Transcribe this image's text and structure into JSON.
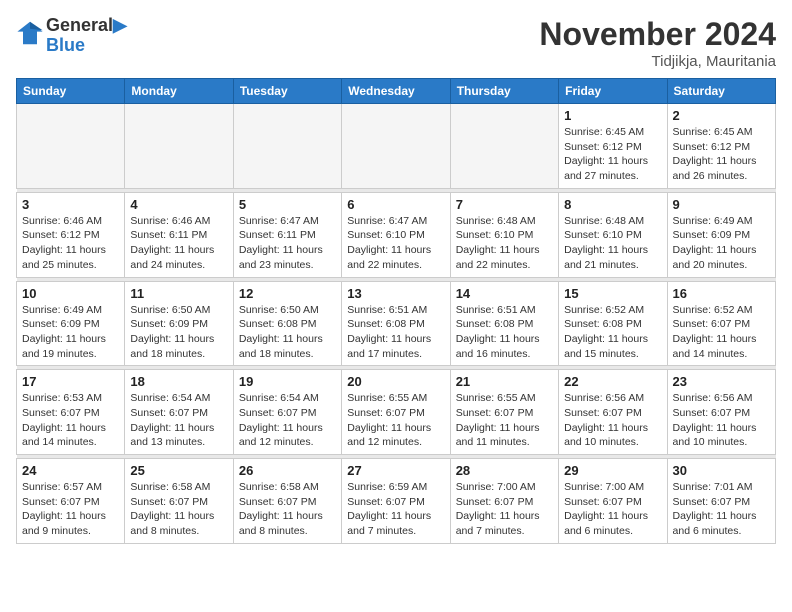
{
  "header": {
    "logo_line1": "General",
    "logo_line2": "Blue",
    "month": "November 2024",
    "location": "Tidjikja, Mauritania"
  },
  "weekdays": [
    "Sunday",
    "Monday",
    "Tuesday",
    "Wednesday",
    "Thursday",
    "Friday",
    "Saturday"
  ],
  "weeks": [
    [
      {
        "day": "",
        "info": ""
      },
      {
        "day": "",
        "info": ""
      },
      {
        "day": "",
        "info": ""
      },
      {
        "day": "",
        "info": ""
      },
      {
        "day": "",
        "info": ""
      },
      {
        "day": "1",
        "info": "Sunrise: 6:45 AM\nSunset: 6:12 PM\nDaylight: 11 hours and 27 minutes."
      },
      {
        "day": "2",
        "info": "Sunrise: 6:45 AM\nSunset: 6:12 PM\nDaylight: 11 hours and 26 minutes."
      }
    ],
    [
      {
        "day": "3",
        "info": "Sunrise: 6:46 AM\nSunset: 6:12 PM\nDaylight: 11 hours and 25 minutes."
      },
      {
        "day": "4",
        "info": "Sunrise: 6:46 AM\nSunset: 6:11 PM\nDaylight: 11 hours and 24 minutes."
      },
      {
        "day": "5",
        "info": "Sunrise: 6:47 AM\nSunset: 6:11 PM\nDaylight: 11 hours and 23 minutes."
      },
      {
        "day": "6",
        "info": "Sunrise: 6:47 AM\nSunset: 6:10 PM\nDaylight: 11 hours and 22 minutes."
      },
      {
        "day": "7",
        "info": "Sunrise: 6:48 AM\nSunset: 6:10 PM\nDaylight: 11 hours and 22 minutes."
      },
      {
        "day": "8",
        "info": "Sunrise: 6:48 AM\nSunset: 6:10 PM\nDaylight: 11 hours and 21 minutes."
      },
      {
        "day": "9",
        "info": "Sunrise: 6:49 AM\nSunset: 6:09 PM\nDaylight: 11 hours and 20 minutes."
      }
    ],
    [
      {
        "day": "10",
        "info": "Sunrise: 6:49 AM\nSunset: 6:09 PM\nDaylight: 11 hours and 19 minutes."
      },
      {
        "day": "11",
        "info": "Sunrise: 6:50 AM\nSunset: 6:09 PM\nDaylight: 11 hours and 18 minutes."
      },
      {
        "day": "12",
        "info": "Sunrise: 6:50 AM\nSunset: 6:08 PM\nDaylight: 11 hours and 18 minutes."
      },
      {
        "day": "13",
        "info": "Sunrise: 6:51 AM\nSunset: 6:08 PM\nDaylight: 11 hours and 17 minutes."
      },
      {
        "day": "14",
        "info": "Sunrise: 6:51 AM\nSunset: 6:08 PM\nDaylight: 11 hours and 16 minutes."
      },
      {
        "day": "15",
        "info": "Sunrise: 6:52 AM\nSunset: 6:08 PM\nDaylight: 11 hours and 15 minutes."
      },
      {
        "day": "16",
        "info": "Sunrise: 6:52 AM\nSunset: 6:07 PM\nDaylight: 11 hours and 14 minutes."
      }
    ],
    [
      {
        "day": "17",
        "info": "Sunrise: 6:53 AM\nSunset: 6:07 PM\nDaylight: 11 hours and 14 minutes."
      },
      {
        "day": "18",
        "info": "Sunrise: 6:54 AM\nSunset: 6:07 PM\nDaylight: 11 hours and 13 minutes."
      },
      {
        "day": "19",
        "info": "Sunrise: 6:54 AM\nSunset: 6:07 PM\nDaylight: 11 hours and 12 minutes."
      },
      {
        "day": "20",
        "info": "Sunrise: 6:55 AM\nSunset: 6:07 PM\nDaylight: 11 hours and 12 minutes."
      },
      {
        "day": "21",
        "info": "Sunrise: 6:55 AM\nSunset: 6:07 PM\nDaylight: 11 hours and 11 minutes."
      },
      {
        "day": "22",
        "info": "Sunrise: 6:56 AM\nSunset: 6:07 PM\nDaylight: 11 hours and 10 minutes."
      },
      {
        "day": "23",
        "info": "Sunrise: 6:56 AM\nSunset: 6:07 PM\nDaylight: 11 hours and 10 minutes."
      }
    ],
    [
      {
        "day": "24",
        "info": "Sunrise: 6:57 AM\nSunset: 6:07 PM\nDaylight: 11 hours and 9 minutes."
      },
      {
        "day": "25",
        "info": "Sunrise: 6:58 AM\nSunset: 6:07 PM\nDaylight: 11 hours and 8 minutes."
      },
      {
        "day": "26",
        "info": "Sunrise: 6:58 AM\nSunset: 6:07 PM\nDaylight: 11 hours and 8 minutes."
      },
      {
        "day": "27",
        "info": "Sunrise: 6:59 AM\nSunset: 6:07 PM\nDaylight: 11 hours and 7 minutes."
      },
      {
        "day": "28",
        "info": "Sunrise: 7:00 AM\nSunset: 6:07 PM\nDaylight: 11 hours and 7 minutes."
      },
      {
        "day": "29",
        "info": "Sunrise: 7:00 AM\nSunset: 6:07 PM\nDaylight: 11 hours and 6 minutes."
      },
      {
        "day": "30",
        "info": "Sunrise: 7:01 AM\nSunset: 6:07 PM\nDaylight: 11 hours and 6 minutes."
      }
    ]
  ]
}
